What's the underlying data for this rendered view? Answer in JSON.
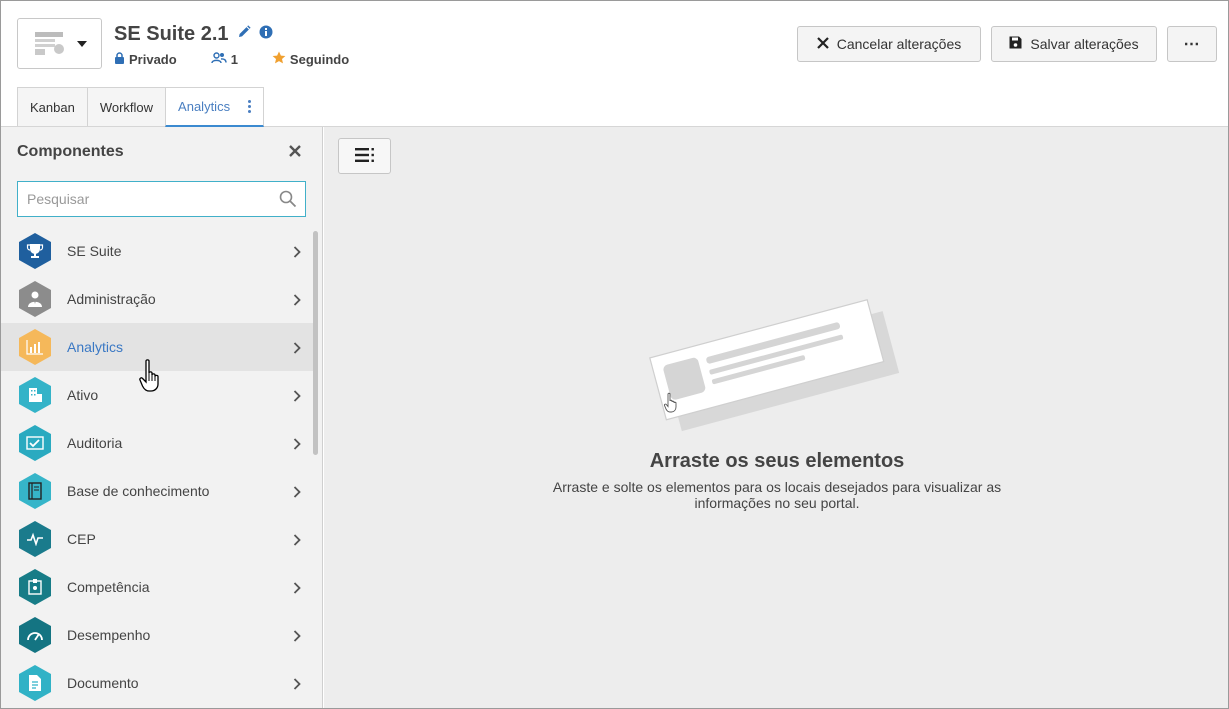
{
  "header": {
    "title": "SE Suite 2.1",
    "privacy": "Privado",
    "members_count": "1",
    "follow_status": "Seguindo",
    "cancel_label": "Cancelar alterações",
    "save_label": "Salvar alterações",
    "more_label": "⋯"
  },
  "tabs": [
    {
      "label": "Kanban",
      "active": false
    },
    {
      "label": "Workflow",
      "active": false
    },
    {
      "label": "Analytics",
      "active": true
    }
  ],
  "sidebar": {
    "title": "Componentes",
    "search_placeholder": "Pesquisar",
    "items": [
      {
        "label": "SE Suite",
        "icon": "trophy-icon",
        "color": "#1f5f9e"
      },
      {
        "label": "Administração",
        "icon": "user-admin-icon",
        "color": "#8c8c8c"
      },
      {
        "label": "Analytics",
        "icon": "bar-chart-icon",
        "color": "#f5b85a"
      },
      {
        "label": "Ativo",
        "icon": "building-icon",
        "color": "#34b3c8"
      },
      {
        "label": "Auditoria",
        "icon": "audit-check-icon",
        "color": "#2aaac0"
      },
      {
        "label": "Base de conhecimento",
        "icon": "book-icon",
        "color": "#36b5c9"
      },
      {
        "label": "CEP",
        "icon": "pulse-icon",
        "color": "#1a7b8c"
      },
      {
        "label": "Competência",
        "icon": "badge-icon",
        "color": "#177c87"
      },
      {
        "label": "Desempenho",
        "icon": "gauge-icon",
        "color": "#147482"
      },
      {
        "label": "Documento",
        "icon": "document-icon",
        "color": "#31b2c6"
      }
    ]
  },
  "main": {
    "empty_title": "Arraste os seus elementos",
    "empty_desc": "Arraste e solte os elementos para os locais desejados para visualizar as informações no seu portal."
  },
  "colors": {
    "accent": "#3a78c4",
    "search_border": "#41b0c9",
    "info": "#2f6fb5",
    "star": "#f0a030"
  }
}
